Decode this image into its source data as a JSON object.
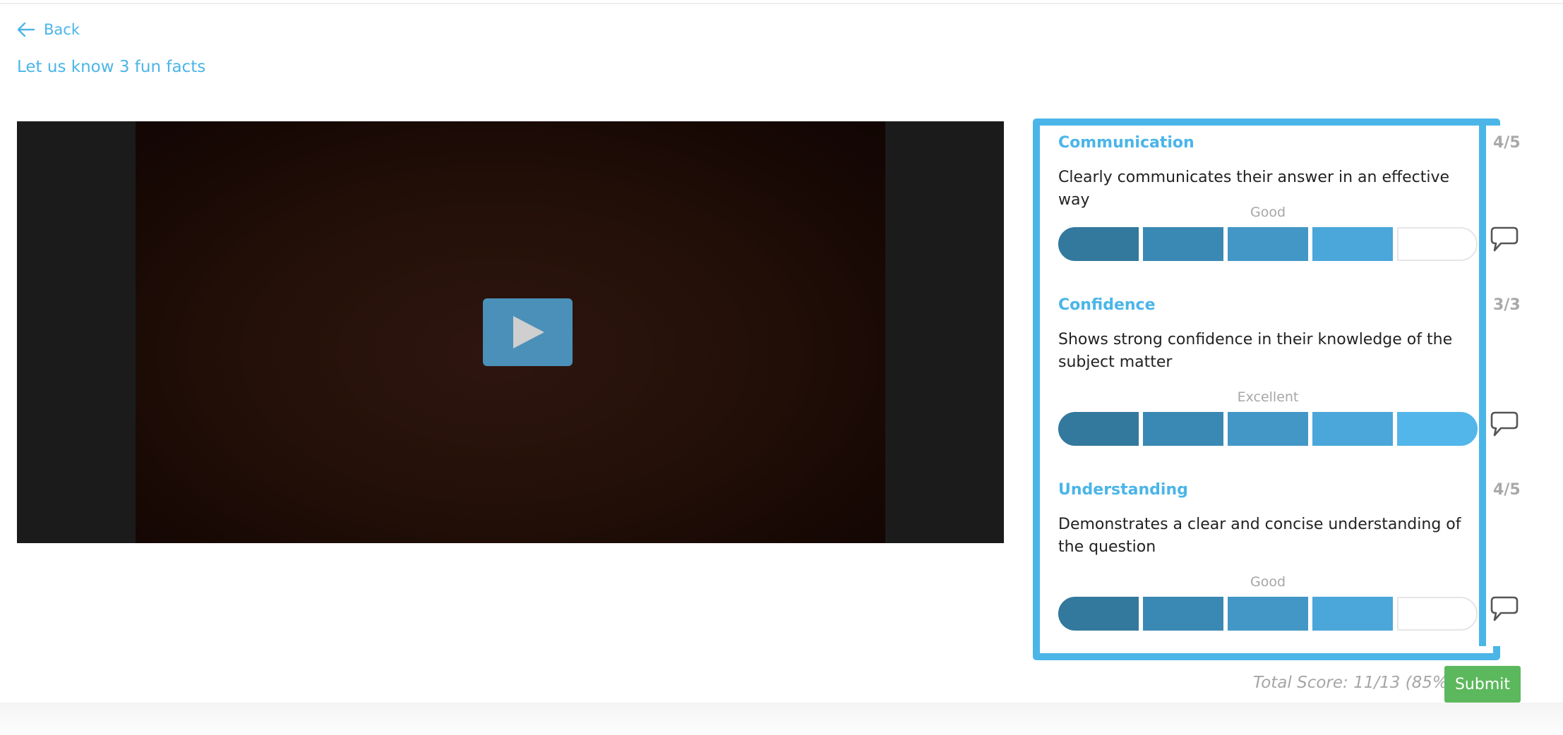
{
  "nav": {
    "back_label": "Back"
  },
  "question": {
    "title": "Let us know 3 fun facts"
  },
  "criteria": [
    {
      "name": "Communication",
      "description": "Clearly communicates their answer in an effective way",
      "score": "4/5",
      "level": "Good",
      "filled": 4,
      "total": 5
    },
    {
      "name": "Confidence",
      "description": "Shows strong confidence in their knowledge of the subject matter",
      "score": "3/3",
      "level": "Excellent",
      "filled": 5,
      "total": 5
    },
    {
      "name": "Understanding",
      "description": "Demonstrates a clear and concise understanding of the question",
      "score": "4/5",
      "level": "Good",
      "filled": 4,
      "total": 5
    }
  ],
  "footer": {
    "total_score": "Total Score: 11/13 (85%)",
    "submit_label": "Submit"
  },
  "icons": {
    "back": "arrow-left-icon",
    "play": "play-icon",
    "comment": "speech-bubble-icon"
  },
  "colors": {
    "accent": "#4bb5e8",
    "submit": "#5cb85c",
    "score_grey": "#a9a9a9"
  }
}
